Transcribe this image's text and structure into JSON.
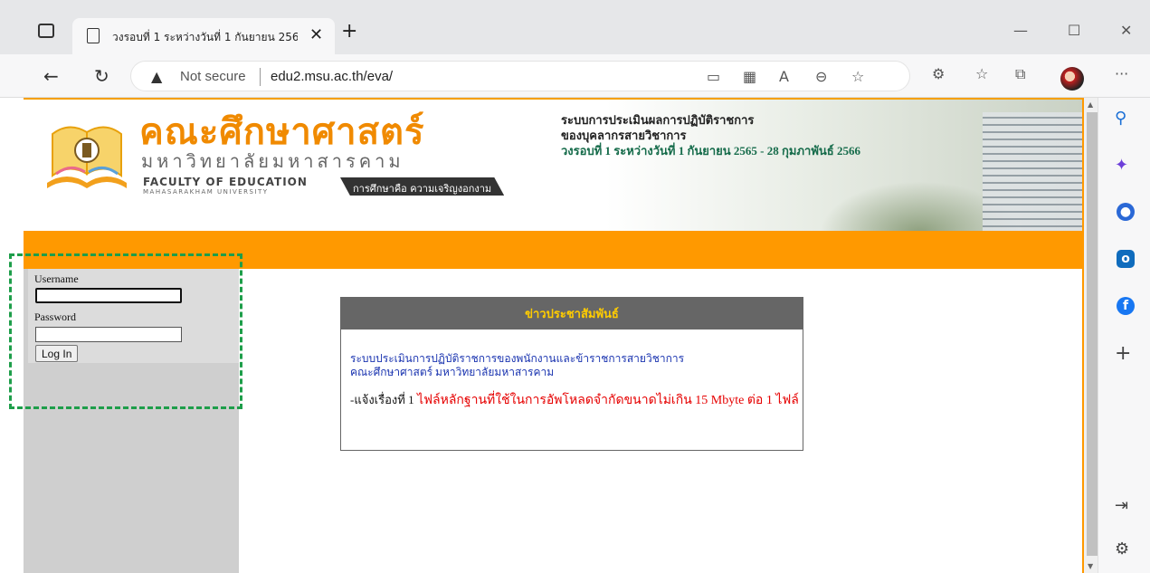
{
  "browser": {
    "tab_title": "วงรอบที่ 1 ระหว่างวันที่ 1 กันยายน 256",
    "tab_close": "✕",
    "new_tab": "+",
    "minimize": "—",
    "maximize": "☐",
    "close": "✕",
    "security_label": "Not secure",
    "url": "edu2.msu.ac.th/eva/",
    "more": "···"
  },
  "header": {
    "logo_thai_main": "คณะศึกษาศาสตร์",
    "logo_thai_sub": "มหาวิทยาลัยมหาสารคาม",
    "logo_en_line1": "FACULTY OF EDUCATION",
    "logo_en_line2": "MAHASARAKHAM UNIVERSITY",
    "logo_slogan": "การศึกษาคือ ความเจริญงอกงาม",
    "title_line1": "ระบบการประเมินผลการปฏิบัติราชการ",
    "title_line2": "ของบุคลากรสายวิชาการ",
    "title_line3": "วงรอบที่ 1 ระหว่างวันที่ 1 กันยายน 2565 - 28 กุมภาพันธ์ 2566"
  },
  "login": {
    "username_label": "Username",
    "username_value": "",
    "password_label": "Password",
    "password_value": "",
    "login_button": "Log In"
  },
  "news": {
    "heading": "ข่าวประชาสัมพันธ์",
    "line1": "ระบบประเมินการปฏิบัติราชการของพนักงานและข้าราชการสายวิชาการ",
    "line2": "คณะศึกษาศาสตร์ มหาวิทยาลัยมหาสารคาม",
    "notice_prefix": "-แจ้งเรื่องที่ 1",
    "notice_body": " ไฟล์หลักฐานที่ใช้ในการอัพโหลดจำกัดขนาดไม่เกิน 15 Mbyte ต่อ 1 ไฟล์"
  },
  "colors": {
    "accent_orange": "#ff9900",
    "title_green": "#156b4a",
    "news_link_blue": "#1a34b0",
    "notice_red": "#e60000",
    "highlight_dashed": "#1e9e4a"
  },
  "icons": {
    "edge_sidebar": [
      "search-icon",
      "copilot-icon",
      "office-icon",
      "outlook-icon",
      "messenger-icon",
      "add-icon",
      "split-screen-icon",
      "settings-icon"
    ]
  }
}
